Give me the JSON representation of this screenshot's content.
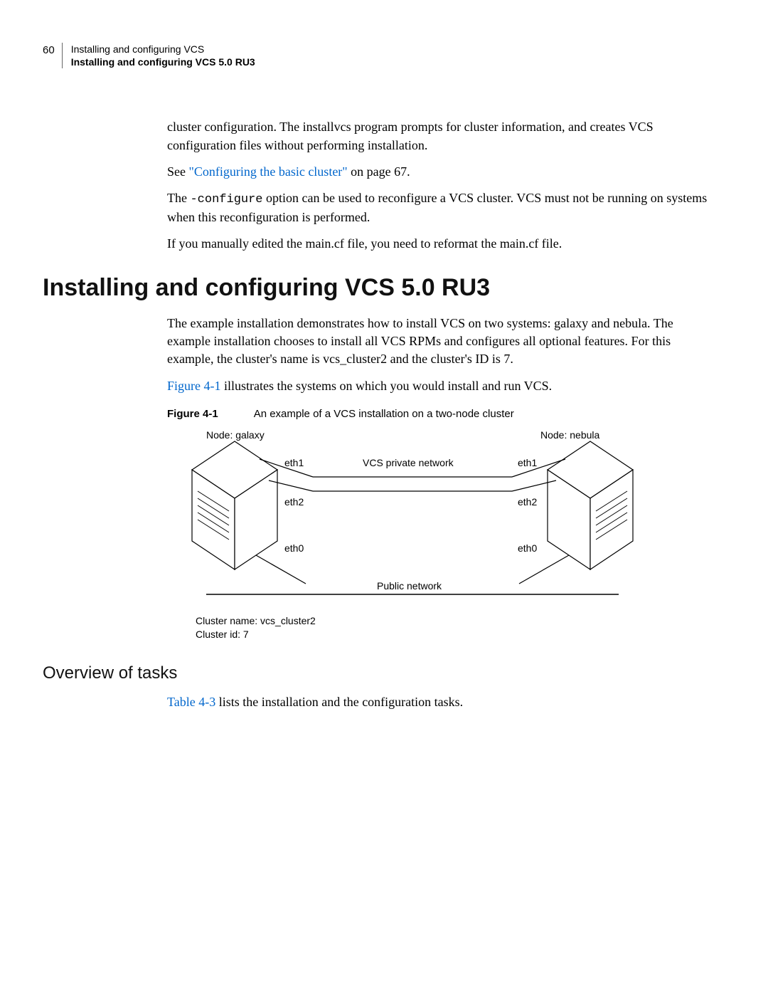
{
  "header": {
    "page_number": "60",
    "line1": "Installing and configuring VCS",
    "line2": "Installing and configuring VCS 5.0 RU3"
  },
  "intro": {
    "p1": "cluster configuration. The installvcs program prompts for cluster information, and creates VCS configuration files without performing installation.",
    "p2_prefix": "See ",
    "p2_link": "\"Configuring the basic cluster\"",
    "p2_suffix": " on page 67.",
    "p3_prefix": "The ",
    "p3_code": "-configure",
    "p3_suffix": " option can be used to reconfigure a VCS cluster. VCS must not be running on systems when this reconfiguration is performed.",
    "p4": "If you manually edited the main.cf file, you need to reformat the main.cf file."
  },
  "section_title": "Installing and configuring VCS 5.0 RU3",
  "section": {
    "p1": "The example installation demonstrates how to install VCS on two systems: galaxy and nebula. The example installation chooses to install all VCS RPMs and configures all optional features. For this example, the cluster's name is vcs_cluster2 and the cluster's ID is 7.",
    "p2_link": "Figure 4-1",
    "p2_suffix": " illustrates the systems on which you would install and run VCS."
  },
  "figure": {
    "label": "Figure 4-1",
    "caption": "An example of a VCS installation on a two-node cluster",
    "node_left": "Node: galaxy",
    "node_right": "Node: nebula",
    "eth1": "eth1",
    "eth2": "eth2",
    "eth0": "eth0",
    "private_net": "VCS private network",
    "public_net": "Public network",
    "cluster_name": "Cluster name: vcs_cluster2",
    "cluster_id": "Cluster id: 7"
  },
  "subsection_title": "Overview of tasks",
  "subsection": {
    "p1_link": "Table 4-3",
    "p1_suffix": " lists the installation and the configuration tasks."
  }
}
